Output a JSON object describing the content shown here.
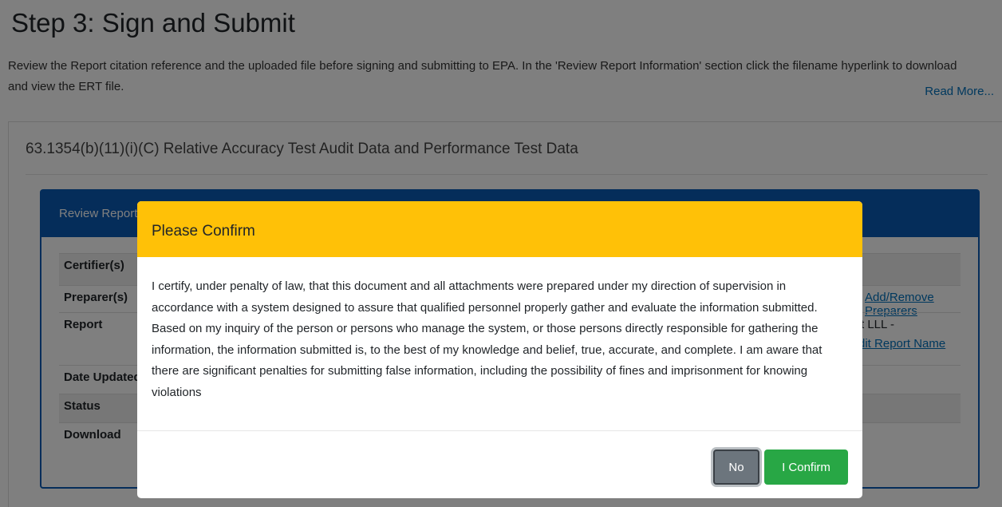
{
  "page": {
    "title": "Step 3: Sign and Submit",
    "description": "Review the Report citation reference and the uploaded file before signing and submitting to EPA. In the 'Review Report Information' section click the filename hyperlink to download and view the ERT file.",
    "read_more": "Read More...",
    "rule_title": "63.1354(b)(11)(i)(C) Relative Accuracy Test Audit Data and Performance Test Data"
  },
  "review": {
    "header": "Review Report Information",
    "rows": [
      {
        "label": "Certifier(s)",
        "value": ""
      },
      {
        "label": "Preparer(s)",
        "value": "Add/Remove Preparers"
      },
      {
        "label": "Report",
        "value": "rt LLL -",
        "value2": "Edit Report Name"
      },
      {
        "label": "Date Updated",
        "value": ""
      },
      {
        "label": "Status",
        "value": ""
      },
      {
        "label": "Download",
        "value": ""
      }
    ]
  },
  "modal": {
    "title": "Please Confirm",
    "body": "I certify, under penalty of law, that this document and all attachments were prepared under my direction of supervision in accordance with a system designed to assure that qualified personnel properly gather and evaluate the information submitted. Based on my inquiry of the person or persons who manage the system, or those persons directly responsible for gathering the information, the information submitted is, to the best of my knowledge and belief, true, accurate, and complete. I am aware that there are significant penalties for submitting false information, including the possibility of fines and imprisonment for knowing violations",
    "no_label": "No",
    "confirm_label": "I Confirm"
  },
  "colors": {
    "warning": "#ffc107",
    "primary": "#0b5bb5",
    "success": "#28a745",
    "secondary": "#6c757d"
  }
}
